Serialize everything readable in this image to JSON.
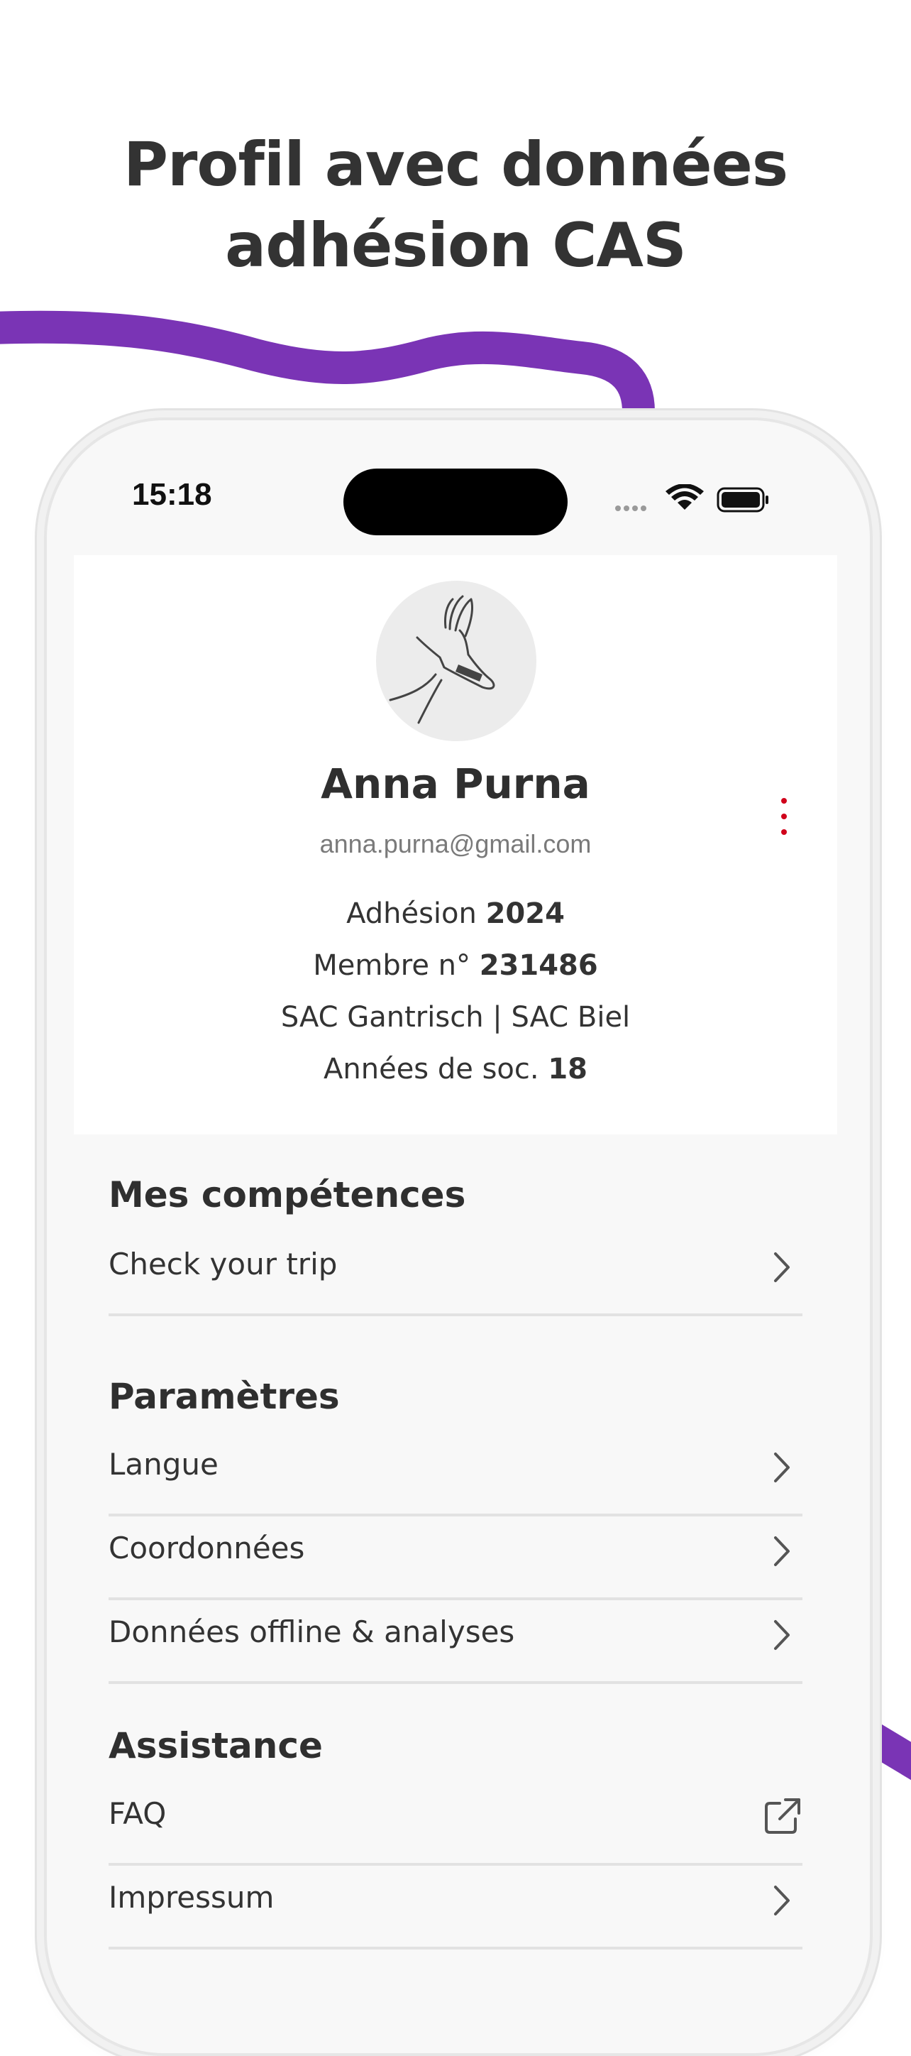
{
  "headline": {
    "line1": "Profil avec données",
    "line2": "adhésion CAS"
  },
  "status_bar": {
    "time": "15:18",
    "icons": [
      "cellular-dots-icon",
      "wifi-icon",
      "battery-icon"
    ]
  },
  "profile": {
    "avatar": "ibex-avatar",
    "name": "Anna Purna",
    "email": "anna.purna@gmail.com",
    "membership_label": "Adhésion",
    "membership_year": "2024",
    "member_no_label": "Membre n°",
    "member_no": "231486",
    "sections": "SAC Gantrisch | SAC Biel",
    "years_label": "Années de soc.",
    "years": "18",
    "menu_icon": "kebab-menu-icon"
  },
  "competences": {
    "title": "Mes compétences",
    "items": [
      {
        "label": "Check your trip",
        "icon": "chevron-right-icon"
      }
    ]
  },
  "parametres": {
    "title": "Paramètres",
    "items": [
      {
        "label": "Langue",
        "icon": "chevron-right-icon"
      },
      {
        "label": "Coordonnées",
        "icon": "chevron-right-icon"
      },
      {
        "label": "Données offline & analyses",
        "icon": "chevron-right-icon"
      }
    ]
  },
  "assistance": {
    "title": "Assistance",
    "items": [
      {
        "label": "FAQ",
        "icon": "external-link-icon"
      },
      {
        "label": "Impressum",
        "icon": "chevron-right-icon"
      }
    ]
  },
  "colors": {
    "accent_purple": "#7a34b5",
    "kebab_red": "#d0021b",
    "text": "#2f2f2f"
  }
}
